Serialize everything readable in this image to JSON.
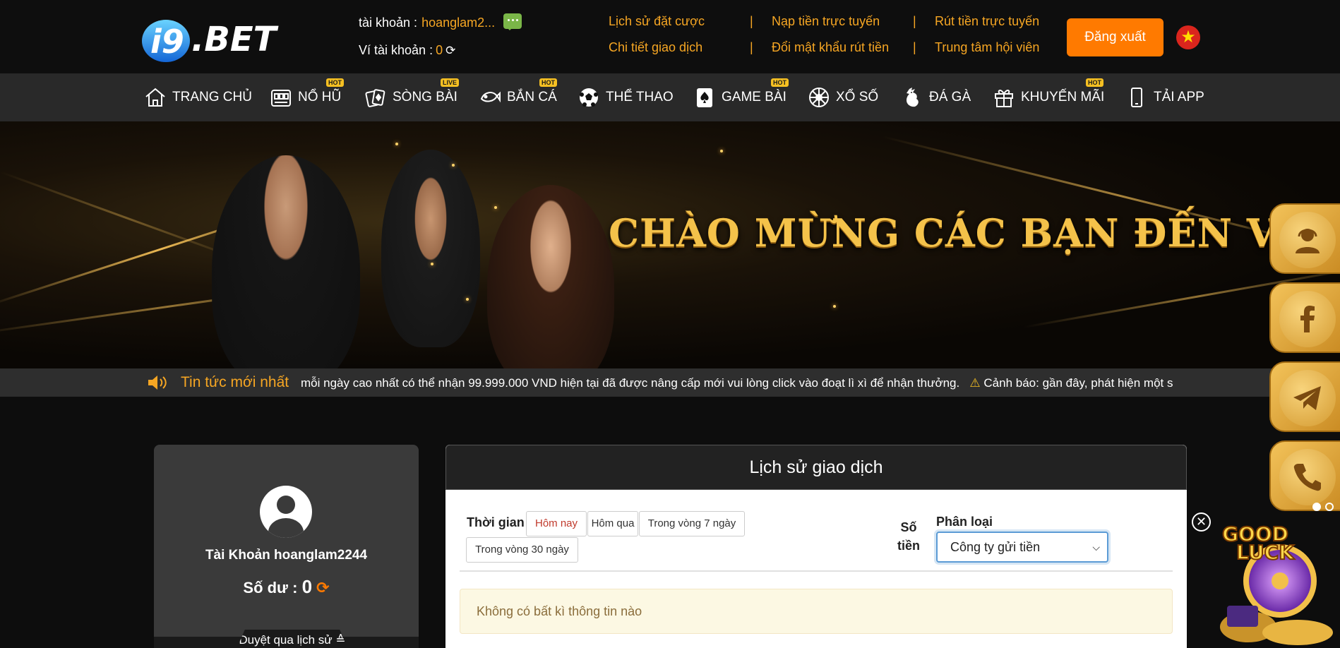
{
  "header": {
    "logo_text": "i9.BET",
    "account_label": "tài khoản :",
    "account_value": "hoanglam2...",
    "wallet_label": "Ví tài khoản :",
    "wallet_value": "0",
    "links_col1": [
      "Lịch sử đặt cược",
      "Chi tiết giao dịch"
    ],
    "links_col2": [
      "Nạp tiền trực tuyến",
      "Đổi mật khẩu rút tiền"
    ],
    "links_col3": [
      "Rút tiền trực tuyến",
      "Trung tâm hội viên"
    ],
    "separator": "|",
    "logout_label": "Đăng xuất",
    "flag_star": "★"
  },
  "nav": {
    "items": [
      {
        "label": "TRANG CHỦ",
        "icon": "home-icon",
        "badge": ""
      },
      {
        "label": "NỔ HŨ",
        "icon": "slot-machine-icon",
        "badge": "HOT"
      },
      {
        "label": "SÒNG BÀI",
        "icon": "cards-icon",
        "badge": "LIVE"
      },
      {
        "label": "BẮN CÁ",
        "icon": "fish-icon",
        "badge": "HOT"
      },
      {
        "label": "THỂ THAO",
        "icon": "soccer-ball-icon",
        "badge": ""
      },
      {
        "label": "GAME BÀI",
        "icon": "spade-card-icon",
        "badge": "HOT"
      },
      {
        "label": "XỔ SỐ",
        "icon": "lottery-wheel-icon",
        "badge": ""
      },
      {
        "label": "ĐÁ GÀ",
        "icon": "rooster-icon",
        "badge": ""
      },
      {
        "label": "KHUYẾN MÃI",
        "icon": "gift-icon",
        "badge": "HOT"
      },
      {
        "label": "TẢI APP",
        "icon": "phone-icon",
        "badge": ""
      }
    ]
  },
  "banner": {
    "title": "CHÀO MỪNG CÁC BẠN ĐẾN VỚI"
  },
  "news": {
    "label": "Tin tức mới nhất",
    "text": "mỗi ngày cao nhất có thể nhận 99.999.000 VND hiện tại đã được nâng cấp mới vui lòng click vào đoạt lì xì để nhận thưởng.",
    "warning_icon": "⚠",
    "warning_text": "Cảnh báo: gần đây, phát hiện một s"
  },
  "profile": {
    "account_name": "Tài Khoản hoanglam2244",
    "balance_label": "Số dư :",
    "balance_value": "0",
    "history_tab": "Duyệt qua lịch sử ≙"
  },
  "transactions": {
    "title": "Lịch sử giao dịch",
    "time_label": "Thời gian",
    "time_filters": [
      "Hôm nay",
      "Hôm qua",
      "Trong vòng 7 ngày",
      "Trong vòng 30 ngày"
    ],
    "amount_label_1": "Số",
    "amount_label_2": "tiền",
    "category_label": "Phân loại",
    "category_selected": "Công ty gửi tiền",
    "empty_message": "Không có bất kì thông tin nào"
  },
  "floating": {
    "buttons": [
      "support-agent-icon",
      "facebook-icon",
      "telegram-icon",
      "phone-call-icon"
    ],
    "close": "✕",
    "promo_text": "GOOD LUCK"
  },
  "colors": {
    "accent": "#f6a623",
    "logout": "#ff7a00",
    "nav_bg": "#292929"
  }
}
